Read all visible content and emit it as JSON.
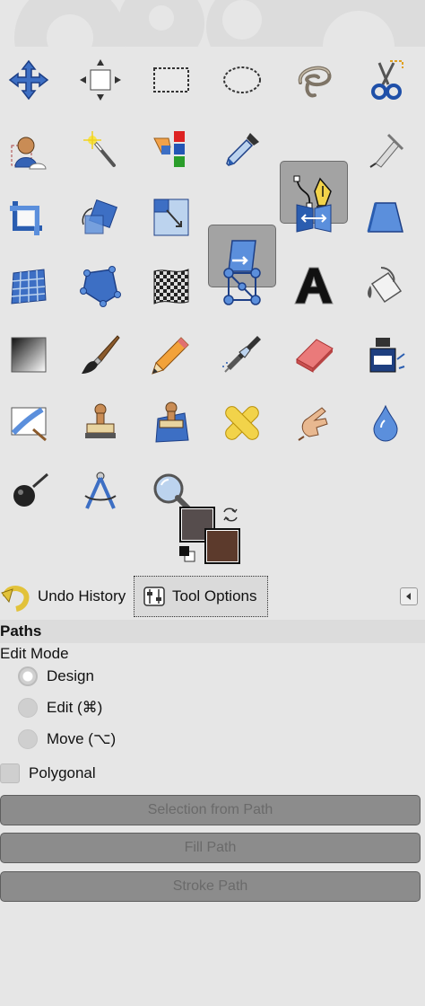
{
  "window": {
    "tools": [
      {
        "name": "move-tool",
        "icon": "move-icon"
      },
      {
        "name": "align-tool",
        "icon": "align-icon"
      },
      {
        "name": "rect-select-tool",
        "icon": "rect-select-icon"
      },
      {
        "name": "ellipse-select-tool",
        "icon": "ellipse-select-icon"
      },
      {
        "name": "free-select-tool",
        "icon": "lasso-icon"
      },
      {
        "name": "scissors-select-tool",
        "icon": "scissors-icon"
      },
      {
        "name": "foreground-select-tool",
        "icon": "foreground-select-icon"
      },
      {
        "name": "fuzzy-select-tool",
        "icon": "magic-wand-icon"
      },
      {
        "name": "by-color-select-tool",
        "icon": "select-by-color-icon"
      },
      {
        "name": "color-picker-tool",
        "icon": "eyedropper-icon"
      },
      {
        "name": "paths-tool",
        "icon": "paths-icon",
        "active": true
      },
      {
        "name": "measure-tool",
        "icon": "compass-icon"
      },
      {
        "name": "crop-tool",
        "icon": "crop-icon"
      },
      {
        "name": "rotate-tool",
        "icon": "rotate-icon"
      },
      {
        "name": "scale-tool",
        "icon": "scale-icon"
      },
      {
        "name": "shear-tool",
        "icon": "shear-icon",
        "active": true
      },
      {
        "name": "flip-tool",
        "icon": "flip-icon"
      },
      {
        "name": "perspective-tool",
        "icon": "perspective-icon"
      },
      {
        "name": "cage-transform-tool",
        "icon": "grid-icon"
      },
      {
        "name": "unified-transform-tool",
        "icon": "cage-icon"
      },
      {
        "name": "warp-transform-tool",
        "icon": "warp-icon"
      },
      {
        "name": "handle-transform-tool",
        "icon": "handle-transform-icon"
      },
      {
        "name": "text-tool",
        "icon": "text-icon"
      },
      {
        "name": "bucket-fill-tool",
        "icon": "bucket-icon"
      },
      {
        "name": "blend-tool",
        "icon": "gradient-icon"
      },
      {
        "name": "paintbrush-tool",
        "icon": "paintbrush-icon"
      },
      {
        "name": "pencil-tool",
        "icon": "pencil-icon"
      },
      {
        "name": "airbrush-tool",
        "icon": "airbrush-icon"
      },
      {
        "name": "eraser-tool",
        "icon": "eraser-icon"
      },
      {
        "name": "ink-tool",
        "icon": "ink-icon"
      },
      {
        "name": "mypaint-brush-tool",
        "icon": "mypaint-icon"
      },
      {
        "name": "clone-tool",
        "icon": "clone-stamp-icon"
      },
      {
        "name": "perspective-clone-tool",
        "icon": "perspective-clone-icon"
      },
      {
        "name": "heal-tool",
        "icon": "bandage-icon"
      },
      {
        "name": "smudge-tool",
        "icon": "smudge-hand-icon"
      },
      {
        "name": "blur-sharpen-tool",
        "icon": "water-drop-icon"
      },
      {
        "name": "dodge-burn-tool",
        "icon": "dodge-burn-icon"
      },
      {
        "name": "measure-compass-tool",
        "icon": "compass-measure-icon"
      },
      {
        "name": "zoom-tool",
        "icon": "magnifier-icon"
      }
    ]
  },
  "colors": {
    "foreground": "#564d4d",
    "background": "#5c3a2c"
  },
  "tabs": {
    "undo_label": "Undo History",
    "options_label": "Tool Options"
  },
  "options": {
    "title": "Paths",
    "mode_label": "Edit Mode",
    "modes": [
      "Design",
      "Edit (⌘)",
      "Move (⌥)"
    ],
    "polygonal_label": "Polygonal",
    "buttons": [
      "Selection from Path",
      "Fill Path",
      "Stroke Path"
    ]
  }
}
